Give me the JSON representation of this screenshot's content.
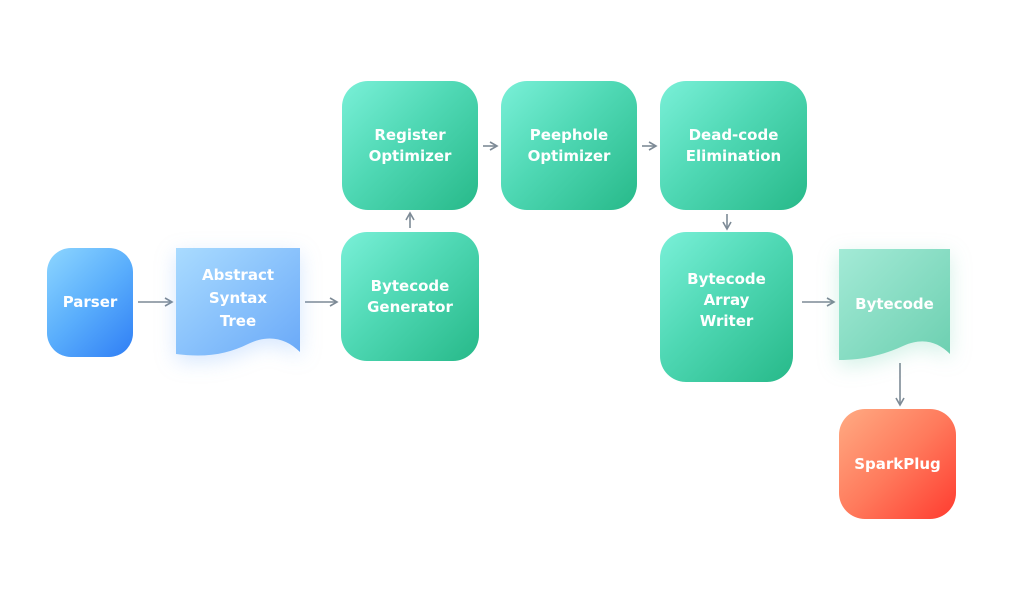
{
  "diagram": {
    "nodes": {
      "parser": {
        "line1": "Parser"
      },
      "ast": {
        "line1": "Abstract",
        "line2": "Syntax",
        "line3": "Tree"
      },
      "bytecode_generator": {
        "line1": "Bytecode",
        "line2": "Generator"
      },
      "register_optimizer": {
        "line1": "Register",
        "line2": "Optimizer"
      },
      "peephole_optimizer": {
        "line1": "Peephole",
        "line2": "Optimizer"
      },
      "dead_code_elimination": {
        "line1": "Dead-code",
        "line2": "Elimination"
      },
      "bytecode_array_writer": {
        "line1": "Bytecode",
        "line2": "Array",
        "line3": "Writer"
      },
      "bytecode": {
        "line1": "Bytecode"
      },
      "sparkplug": {
        "line1": "SparkPlug"
      }
    },
    "edges": [
      {
        "from": "Parser",
        "to": "Abstract Syntax Tree"
      },
      {
        "from": "Abstract Syntax Tree",
        "to": "Bytecode Generator"
      },
      {
        "from": "Bytecode Generator",
        "to": "Register Optimizer"
      },
      {
        "from": "Register Optimizer",
        "to": "Peephole Optimizer"
      },
      {
        "from": "Peephole Optimizer",
        "to": "Dead-code Elimination"
      },
      {
        "from": "Dead-code Elimination",
        "to": "Bytecode Array Writer"
      },
      {
        "from": "Bytecode Array Writer",
        "to": "Bytecode"
      },
      {
        "from": "Bytecode",
        "to": "SparkPlug"
      }
    ],
    "colors": {
      "process": "#3fcf9f",
      "input": "#4a9ef9",
      "document_ast": "#7ab8fb",
      "document_bytecode": "#7fd9bd",
      "output": "#ff5a44",
      "arrow": "#7d8a96"
    }
  }
}
